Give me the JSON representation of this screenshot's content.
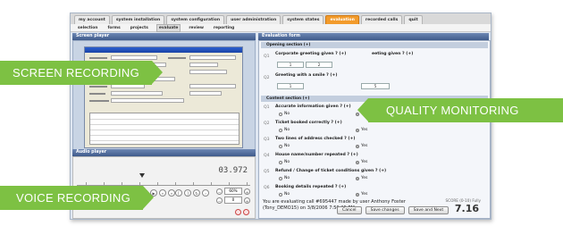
{
  "nav": {
    "tabs": [
      "my account",
      "system installation",
      "system configuration",
      "user administration",
      "system states",
      "evaluation",
      "recorded calls",
      "quit"
    ],
    "active_index": 5
  },
  "subnav": {
    "tabs": [
      "selection",
      "forms",
      "projects",
      "evaluate",
      "review",
      "reporting"
    ],
    "active_index": 3
  },
  "screen_player": {
    "title": "Screen player"
  },
  "audio_player": {
    "title": "Audio player",
    "time": "03.972",
    "playhead_label": "0",
    "volume": "60%",
    "speed": "0"
  },
  "evaluation": {
    "title": "Evaluation form",
    "sections": [
      {
        "label": "Opening section (+)"
      },
      {
        "label": "Content section (+)"
      }
    ],
    "opening_questions": [
      {
        "num": "Q1",
        "text": "Corporate greeting given ? (+)",
        "aside": "eeting given ? (+)",
        "inputs": [
          "1",
          "2"
        ]
      },
      {
        "num": "Q2",
        "text": "Greeting with a smile ? (+)",
        "inputs": [
          "1",
          "5"
        ]
      }
    ],
    "content_questions": [
      {
        "num": "Q1",
        "text": "Accurate information given ? (+)",
        "selected": "Yes"
      },
      {
        "num": "Q2",
        "text": "Ticket booked correctly ? (+)",
        "selected": "Yes"
      },
      {
        "num": "Q3",
        "text": "Two lines of address checked ? (+)",
        "selected": "Yes"
      },
      {
        "num": "Q4",
        "text": "House name/number repeated ? (+)",
        "selected": "Yes"
      },
      {
        "num": "Q5",
        "text": "Refund / Change of ticket conditions given ? (+)",
        "selected": "Yes"
      },
      {
        "num": "Q6",
        "text": "Booking details repeated ? (+)",
        "selected": "Yes"
      }
    ],
    "no_label": "No",
    "yes_label": "Yes",
    "summary": "You are evaluating call #695447 made by user Anthony Foster (Tony_DEMO15) on 3/8/2006 7:56:25 PM.",
    "score_label": "SCORE (0-10) Fully",
    "score": "7.16",
    "buttons": {
      "cancel": "Cancel",
      "save": "Save changes",
      "save_next": "Save and Next"
    }
  },
  "callouts": {
    "screen": "SCREEN RECORDING",
    "quality": "QUALITY MONITORING",
    "voice": "VOICE RECORDING"
  },
  "colors": {
    "callout_green": "#7dc143",
    "active_tab": "#f29b2c",
    "panel_header": "#4a6594"
  }
}
